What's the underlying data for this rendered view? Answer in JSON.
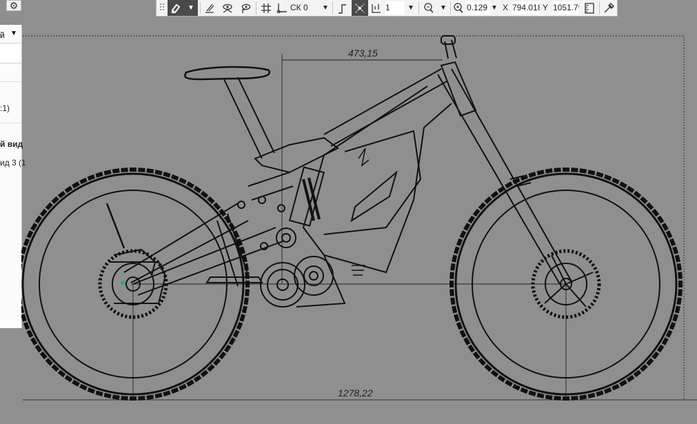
{
  "toolbar": {
    "cs_label": "СК 0",
    "step_value": "1",
    "zoom_value": "0.129",
    "x_label": "X",
    "x_value": "794.018",
    "y_label": "Y",
    "y_value": "1051.79"
  },
  "left_panel": {
    "dropdown_text": "й",
    "scale_text": ":1)",
    "view_header": "й вид",
    "view_item": "ид 3 (1"
  },
  "drawing": {
    "dimension_top": "473,15",
    "dimension_bottom": "1278,22"
  },
  "icons": [
    "gear-icon",
    "grip-icon",
    "magnet-icon",
    "snap-icon",
    "visibility-icon",
    "visibility-reset-icon",
    "grid-icon",
    "coordinate-system-icon",
    "ortho-icon",
    "tracking-icon",
    "step-icon",
    "zoom-region-icon",
    "zoom-icon",
    "measure-icon",
    "eyedropper-icon"
  ]
}
